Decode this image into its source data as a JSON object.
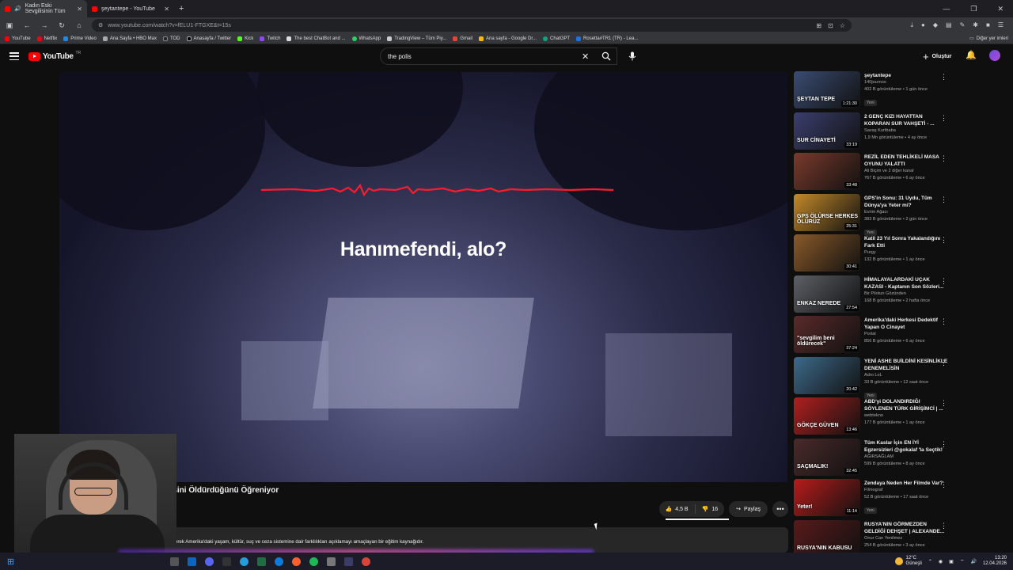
{
  "browser": {
    "tabs": [
      {
        "label": "Kadın Eski Sevgilisinin Tüm",
        "active": true
      },
      {
        "label": "şeytantepe - YouTube",
        "active": false
      }
    ],
    "new_tab": "+",
    "url": "www.youtube.com/watch?v=fELU1-FTGXE&t=15s",
    "bookmarks": [
      "YouTube",
      "Netflix",
      "Prime Video",
      "Ana Sayfa • HBO Max",
      "TOD",
      "Anasayfa / Twitter",
      "Kick",
      "Twitch",
      "The best ChatBot and ...",
      "WhatsApp",
      "TradingView – Tüm Piy...",
      "Gmail",
      "Ana sayfa - Google Dr...",
      "ChatGPT",
      "Rosetta#TR1 (TR) - Lea..."
    ],
    "bookmarks_other": "Diğer yer imleri"
  },
  "header": {
    "logo": "YouTube",
    "country": "TR",
    "search_value": "the polis",
    "create_label": "Oluştur"
  },
  "player": {
    "subtitle": "Hanımefendi, alo?"
  },
  "video": {
    "title_visible": "lesini Öldürdüğünü Öğreniyor",
    "likes": "4,5 B",
    "dislikes": "16",
    "share": "Paylaş",
    "description": "ederek Amerika'daki yaşam, kültür, suç ve ceza sistemine dair farklılıkları açıklamayı amaçlayan bir eğitim kaynağıdır."
  },
  "sidebar": [
    {
      "title": "şeytantepe",
      "channel": "140journos",
      "views": "402 B görüntüleme • 1 gün önce",
      "badge": "Yeni",
      "duration": "1:21:30",
      "caption": "ŞEYTAN TEPE",
      "color": "#3a4c72"
    },
    {
      "title": "2 GENÇ KIZI HAYATTAN KOPARAN SUR VAHŞETİ - ...",
      "channel": "Savaş Kurtbaba",
      "views": "1,9 Mn görüntüleme • 4 ay önce",
      "badge": "",
      "duration": "33:19",
      "caption": "SUR CİNAYETİ",
      "color": "#3b3f6e"
    },
    {
      "title": "REZİL EDEN TEHLİKELİ MASA OYUNU YALATTI",
      "channel": "Ali Biçim ve 2 diğer kanal",
      "views": "767 B görüntüleme • 6 ay önce",
      "badge": "",
      "duration": "33:48",
      "caption": "",
      "color": "#7a3a2c"
    },
    {
      "title": "GPS'in Sonu: 31 Uydu, Tüm Dünya'ya Yeter mi?",
      "channel": "Evrim Ağacı",
      "views": "383 B görüntüleme • 2 gün önce",
      "badge": "Yeni",
      "duration": "25:31",
      "caption": "GPS ÖLÜRSE HERKES ÖLÜRÜZ",
      "color": "#c58a2a"
    },
    {
      "title": "Katil 23 Yıl Sonra Yakalandığını Fark Etti",
      "channel": "Purgy",
      "views": "132 B görüntüleme • 1 ay önce",
      "badge": "",
      "duration": "30:41",
      "caption": "",
      "color": "#8a5a2a"
    },
    {
      "title": "HİMALAYALARDAKİ UÇAK KAZASI - Kaptanın Son Sözleri...",
      "channel": "Bir Pilotun Gözünden",
      "views": "168 B görüntüleme • 2 hafta önce",
      "badge": "",
      "duration": "27:54",
      "caption": "ENKAZ NEREDE",
      "color": "#5d6066"
    },
    {
      "title": "Amerika'daki Herkesi Dedektif Yapan O Cinayet",
      "channel": "Portal",
      "views": "856 B görüntüleme • 6 ay önce",
      "badge": "",
      "duration": "37:24",
      "caption": "\"sevgilim beni öldürecek\"",
      "color": "#5a2a2a"
    },
    {
      "title": "YENİ ASHE BUİLDİNİ KESİNLİKLE DENEMELİSİN",
      "channel": "Adro LoL",
      "views": "33 B görüntüleme • 12 saat önce",
      "badge": "Yeni",
      "duration": "20:42",
      "caption": "",
      "color": "#3e6a8a"
    },
    {
      "title": "ABD'yi DOLANDIRDIĞI SÖYLENEN TÜRK GİRİŞİMCİ | ...",
      "channel": "webtekno",
      "views": "177 B görüntüleme • 1 ay önce",
      "badge": "",
      "duration": "13:46",
      "caption": "GÖKÇE GÜVEN",
      "color": "#b02020"
    },
    {
      "title": "Tüm Kaslar İçin EN İYİ Egzersizleri @gokalaf 'la Seçtik!",
      "channel": "AĞIRSAĞLAM",
      "views": "599 B görüntüleme • 8 ay önce",
      "badge": "",
      "duration": "32:45",
      "caption": "SAÇMALIK!",
      "color": "#4a2a2a"
    },
    {
      "title": "Zendaya Neden Her Filmde Var?",
      "channel": "Filmograf",
      "views": "52 B görüntüleme • 17 saat önce",
      "badge": "Yeni",
      "duration": "11:14",
      "caption": "Yeter!",
      "color": "#b81c1c"
    },
    {
      "title": "RUSYA'NIN GÖRMEZDEN GELDİĞİ DEHŞET | ALEXANDE...",
      "channel": "Onur Can Yenilmez",
      "views": "254 B görüntüleme • 3 ay önce",
      "badge": "",
      "duration": "",
      "caption": "RUSYA'NIN KABUSU",
      "color": "#5a1a1a"
    }
  ],
  "taskbar": {
    "temp": "12°C",
    "weather": "Güneşli",
    "time": "13:20",
    "date": "12.04.2026"
  },
  "colors": {
    "accent": "#ff0000",
    "background": "#0f0f0f",
    "wave": "#ff1b2d"
  }
}
